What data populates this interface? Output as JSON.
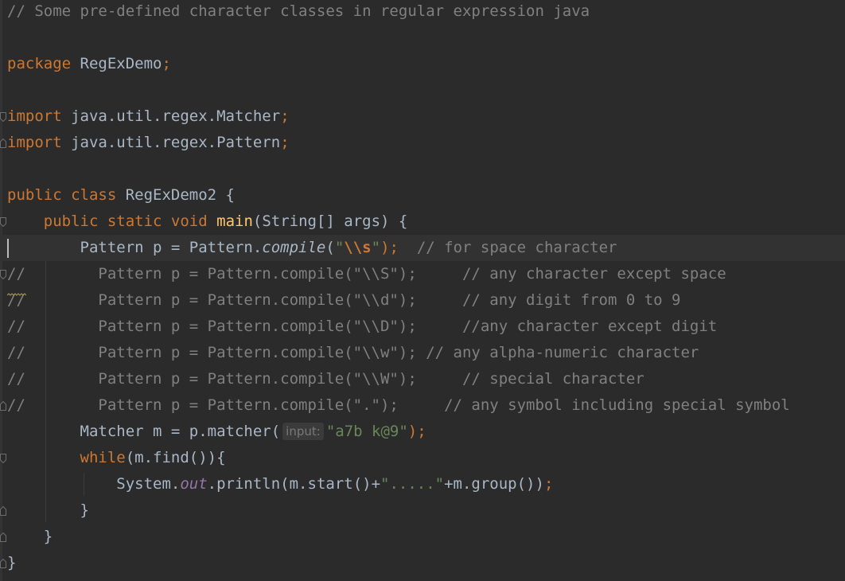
{
  "editor": {
    "colors": {
      "background": "#2b2b2b",
      "current_line": "#323232",
      "comment": "#808080",
      "keyword": "#cc7832",
      "identifier": "#a9b7c6",
      "method_declaration": "#ffc66d",
      "string": "#6a8759",
      "static_field": "#9876aa",
      "inlay_hint_bg": "#3b3b3b",
      "inlay_hint_text": "#787878"
    },
    "current_line_index": 9,
    "lines": [
      [
        {
          "t": "// Some pre-defined character classes in regular expression java",
          "c": "comment"
        }
      ],
      [],
      [
        {
          "t": "package",
          "c": "keyword"
        },
        {
          "t": " RegExDemo",
          "c": "ident"
        },
        {
          "t": ";",
          "c": "keyword"
        }
      ],
      [],
      [
        {
          "t": "import",
          "c": "keyword"
        },
        {
          "t": " java.util.regex.Matcher",
          "c": "ident"
        },
        {
          "t": ";",
          "c": "keyword"
        }
      ],
      [
        {
          "t": "import",
          "c": "keyword"
        },
        {
          "t": " java.util.regex.Pattern",
          "c": "ident"
        },
        {
          "t": ";",
          "c": "keyword"
        }
      ],
      [],
      [
        {
          "t": "public class",
          "c": "keyword"
        },
        {
          "t": " RegExDemo2 {",
          "c": "ident"
        }
      ],
      [
        {
          "t": "    public static void",
          "c": "keyword"
        },
        {
          "t": " ",
          "c": "ident"
        },
        {
          "t": "main",
          "c": "method"
        },
        {
          "t": "(String[] args) {",
          "c": "ident"
        }
      ],
      [
        {
          "t": "        Pattern p = Pattern.",
          "c": "ident"
        },
        {
          "t": "compile",
          "c": "ident italic"
        },
        {
          "t": "(",
          "c": "ident"
        },
        {
          "t": "\"",
          "c": "string"
        },
        {
          "t": "\\\\s",
          "c": "escape"
        },
        {
          "t": "\"",
          "c": "string"
        },
        {
          "t": ");",
          "c": "keyword"
        },
        {
          "t": "  // for space character",
          "c": "comment"
        }
      ],
      [
        {
          "t": "//        Pattern p = Pattern.compile(\"\\\\S\");     // any character except space",
          "c": "comment"
        }
      ],
      [
        {
          "t": "//        Pattern p = Pattern.compile(\"\\\\d\");     // any digit from 0 to 9",
          "c": "comment"
        }
      ],
      [
        {
          "t": "//        Pattern p = Pattern.compile(\"\\\\D\");     //any character except digit",
          "c": "comment"
        }
      ],
      [
        {
          "t": "//        Pattern p = Pattern.compile(\"\\\\w\"); // any alpha-numeric character",
          "c": "comment"
        }
      ],
      [
        {
          "t": "//        Pattern p = Pattern.compile(\"\\\\W\");     // special character",
          "c": "comment"
        }
      ],
      [
        {
          "t": "//        Pattern p = Pattern.compile(\".\");     // any symbol including special symbol",
          "c": "comment"
        }
      ],
      [
        {
          "t": "        Matcher m = p.matcher(",
          "c": "ident"
        },
        {
          "t": "input:",
          "c": "hint"
        },
        {
          "t": "\"a7b k@9\"",
          "c": "string"
        },
        {
          "t": ");",
          "c": "keyword"
        }
      ],
      [
        {
          "t": "        while",
          "c": "keyword"
        },
        {
          "t": "(m.find()){",
          "c": "ident"
        }
      ],
      [
        {
          "t": "            System.",
          "c": "ident"
        },
        {
          "t": "out",
          "c": "field"
        },
        {
          "t": ".println(m.start()+",
          "c": "ident"
        },
        {
          "t": "\".....\"",
          "c": "string"
        },
        {
          "t": "+m.group())",
          "c": "ident"
        },
        {
          "t": ";",
          "c": "keyword"
        }
      ],
      [
        {
          "t": "        }",
          "c": "ident"
        }
      ],
      [
        {
          "t": "    }",
          "c": "ident"
        }
      ],
      [
        {
          "t": "}",
          "c": "ident"
        }
      ]
    ]
  }
}
